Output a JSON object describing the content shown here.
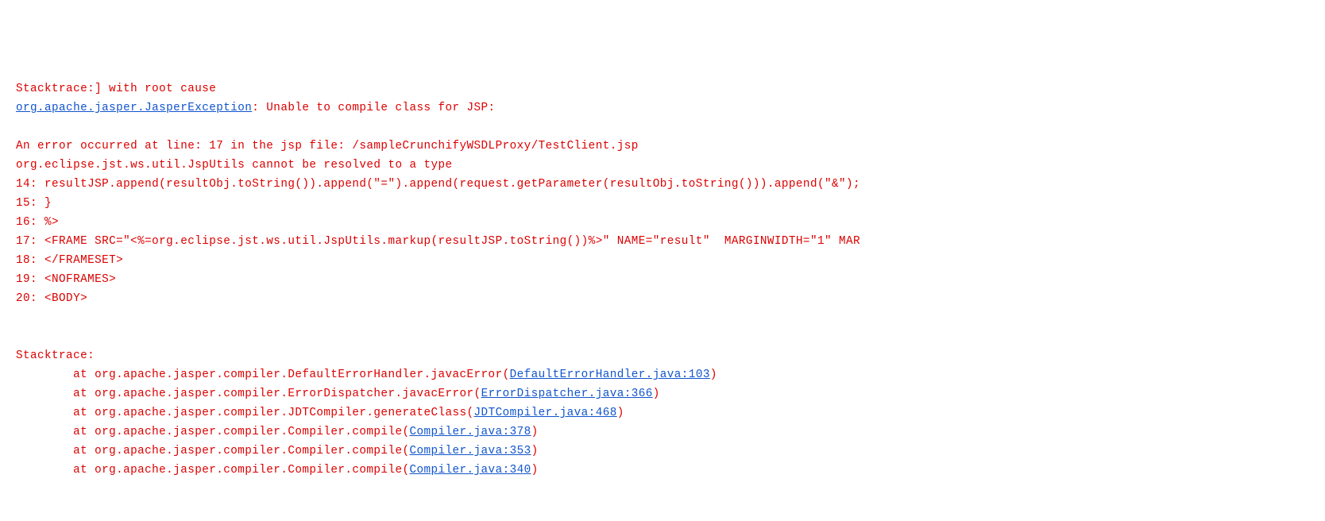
{
  "header": {
    "line1": "Stacktrace:] with root cause",
    "exception_link": "org.apache.jasper.JasperException",
    "exception_suffix": ": Unable to compile class for JSP:"
  },
  "error_block": {
    "blank1": "",
    "line_error": "An error occurred at line: 17 in the jsp file: /sampleCrunchifyWSDLProxy/TestClient.jsp",
    "type_error": "org.eclipse.jst.ws.util.JspUtils cannot be resolved to a type",
    "code14": "14: resultJSP.append(resultObj.toString()).append(\"=\").append(request.getParameter(resultObj.toString())).append(\"&\");",
    "code15": "15: }",
    "code16": "16: %>",
    "code17": "17: <FRAME SRC=\"<%=org.eclipse.jst.ws.util.JspUtils.markup(resultJSP.toString())%>\" NAME=\"result\"  MARGINWIDTH=\"1\" MAR",
    "code18": "18: </FRAMESET>",
    "code19": "19: <NOFRAMES>",
    "code20": "20: <BODY>"
  },
  "stacktrace": {
    "label": "Stacktrace:",
    "frames": [
      {
        "prefix": "        at org.apache.jasper.compiler.DefaultErrorHandler.javacError(",
        "link": "DefaultErrorHandler.java:103",
        "suffix": ")"
      },
      {
        "prefix": "        at org.apache.jasper.compiler.ErrorDispatcher.javacError(",
        "link": "ErrorDispatcher.java:366",
        "suffix": ")"
      },
      {
        "prefix": "        at org.apache.jasper.compiler.JDTCompiler.generateClass(",
        "link": "JDTCompiler.java:468",
        "suffix": ")"
      },
      {
        "prefix": "        at org.apache.jasper.compiler.Compiler.compile(",
        "link": "Compiler.java:378",
        "suffix": ")"
      },
      {
        "prefix": "        at org.apache.jasper.compiler.Compiler.compile(",
        "link": "Compiler.java:353",
        "suffix": ")"
      },
      {
        "prefix": "        at org.apache.jasper.compiler.Compiler.compile(",
        "link": "Compiler.java:340",
        "suffix": ")"
      }
    ]
  }
}
